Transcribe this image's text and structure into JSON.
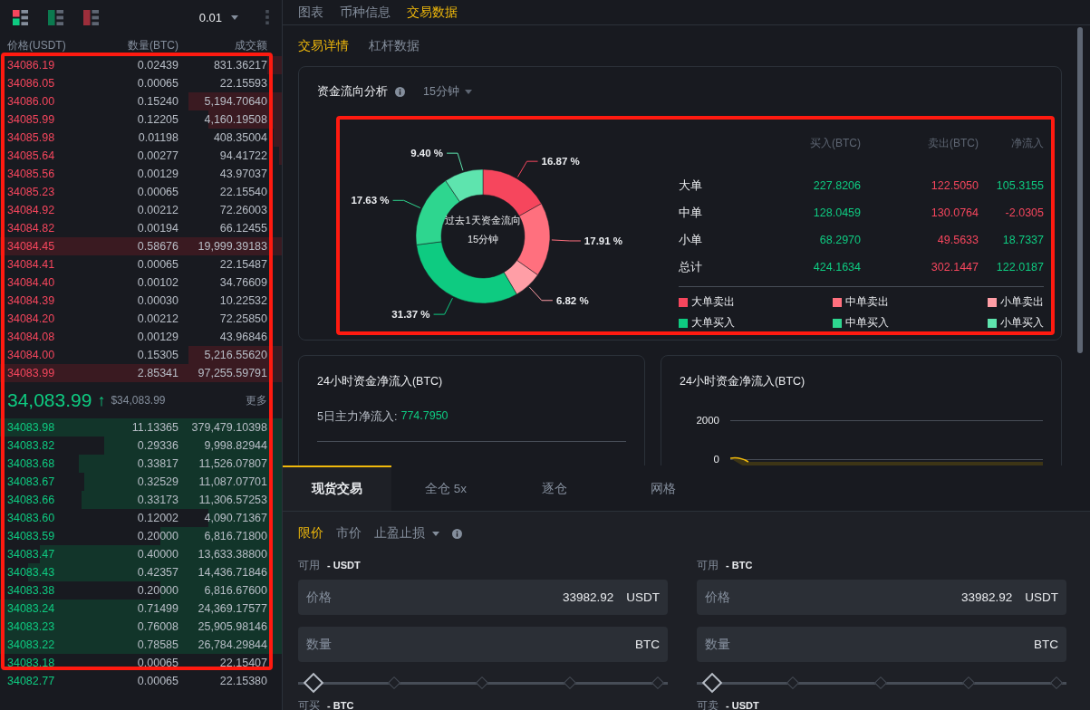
{
  "orderbook": {
    "highlighted": true,
    "precision": "0.01",
    "columns": [
      "价格(USDT)",
      "数量(BTC)",
      "成交额"
    ],
    "asks": [
      {
        "price": "34086.19",
        "quantity": "0.02439",
        "total": "831.36217",
        "level": 0.05
      },
      {
        "price": "34086.05",
        "quantity": "0.00065",
        "total": "22.15593"
      },
      {
        "price": "34086.00",
        "quantity": "0.15240",
        "total": "5,194.70640",
        "level": 0.33
      },
      {
        "price": "34085.99",
        "quantity": "0.12205",
        "total": "4,160.19508",
        "level": 0.26
      },
      {
        "price": "34085.98",
        "quantity": "0.01198",
        "total": "408.35004",
        "level": 0.03
      },
      {
        "price": "34085.64",
        "quantity": "0.00277",
        "total": "94.41722",
        "level": 0.01
      },
      {
        "price": "34085.56",
        "quantity": "0.00129",
        "total": "43.97037"
      },
      {
        "price": "34085.23",
        "quantity": "0.00065",
        "total": "22.15540"
      },
      {
        "price": "34084.92",
        "quantity": "0.00212",
        "total": "72.26003"
      },
      {
        "price": "34084.82",
        "quantity": "0.00194",
        "total": "66.12455"
      },
      {
        "price": "34084.45",
        "quantity": "0.58676",
        "total": "19,999.39183",
        "level": 1
      },
      {
        "price": "34084.41",
        "quantity": "0.00065",
        "total": "22.15487"
      },
      {
        "price": "34084.40",
        "quantity": "0.00102",
        "total": "34.76609"
      },
      {
        "price": "34084.39",
        "quantity": "0.00030",
        "total": "10.22532"
      },
      {
        "price": "34084.20",
        "quantity": "0.00212",
        "total": "72.25850"
      },
      {
        "price": "34084.08",
        "quantity": "0.00129",
        "total": "43.96846"
      },
      {
        "price": "34084.00",
        "quantity": "0.15305",
        "total": "5,216.55620",
        "level": 0.33
      },
      {
        "price": "34083.99",
        "quantity": "2.85341",
        "total": "97,255.59791",
        "level": 1
      }
    ],
    "last_price": {
      "price": "34,083.99",
      "arrow": "↑",
      "usd": "$34,083.99",
      "more": "更多"
    },
    "bids": [
      {
        "price": "34083.98",
        "quantity": "11.13365",
        "total": "379,479.10398",
        "level": 1
      },
      {
        "price": "34083.82",
        "quantity": "0.29336",
        "total": "9,998.82944",
        "level": 0.63
      },
      {
        "price": "34083.68",
        "quantity": "0.33817",
        "total": "11,526.07807",
        "level": 0.72
      },
      {
        "price": "34083.67",
        "quantity": "0.32529",
        "total": "11,087.07701",
        "level": 0.7
      },
      {
        "price": "34083.66",
        "quantity": "0.33173",
        "total": "11,306.57253",
        "level": 0.71
      },
      {
        "price": "34083.60",
        "quantity": "0.12002",
        "total": "4,090.71367",
        "level": 0.26
      },
      {
        "price": "34083.59",
        "quantity": "0.20000",
        "total": "6,816.71800",
        "level": 0.43
      },
      {
        "price": "34083.47",
        "quantity": "0.40000",
        "total": "13,633.38800",
        "level": 0.86
      },
      {
        "price": "34083.43",
        "quantity": "0.42357",
        "total": "14,436.71846",
        "level": 0.9
      },
      {
        "price": "34083.38",
        "quantity": "0.20000",
        "total": "6,816.67600",
        "level": 0.43
      },
      {
        "price": "34083.24",
        "quantity": "0.71499",
        "total": "24,369.17577",
        "level": 1
      },
      {
        "price": "34083.23",
        "quantity": "0.76008",
        "total": "25,905.98146",
        "level": 1
      },
      {
        "price": "34083.22",
        "quantity": "0.78585",
        "total": "26,784.29844",
        "level": 1
      },
      {
        "price": "34083.18",
        "quantity": "0.00065",
        "total": "22.15407"
      },
      {
        "price": "34082.77",
        "quantity": "0.00065",
        "total": "22.15380"
      }
    ]
  },
  "main_tabs": [
    {
      "label": "图表",
      "selected": false
    },
    {
      "label": "币种信息",
      "selected": false
    },
    {
      "label": "交易数据",
      "selected": true
    }
  ],
  "sub_tabs": [
    {
      "label": "交易详情",
      "selected": true
    },
    {
      "label": "杠杆数据",
      "selected": false
    }
  ],
  "flow_analysis": {
    "title": "资金流向分析",
    "interval": "15分钟",
    "highlighted": true,
    "center_title": "过去1天资金流向",
    "center_subtitle": "15分钟",
    "chart_data": {
      "type": "donut",
      "categories": [
        "大单卖出",
        "中单卖出",
        "小单卖出",
        "大单买入",
        "中单买入",
        "小单买入"
      ],
      "values": [
        16.87,
        17.91,
        6.82,
        31.37,
        17.63,
        9.4
      ],
      "value_labels": [
        "16.87 %",
        "17.91 %",
        "6.82 %",
        "31.37 %",
        "17.63 %",
        "9.40 %"
      ]
    },
    "table": {
      "columns": [
        "买入(BTC)",
        "卖出(BTC)",
        "净流入"
      ],
      "rows": [
        {
          "label": "大单",
          "buy": "227.8206",
          "sell": "122.5050",
          "net": "105.3155",
          "net_negative": false
        },
        {
          "label": "中单",
          "buy": "128.0459",
          "sell": "130.0764",
          "net": "-2.0305",
          "net_negative": true
        },
        {
          "label": "小单",
          "buy": "68.2970",
          "sell": "49.5633",
          "net": "18.7337",
          "net_negative": false
        },
        {
          "label": "总计",
          "buy": "424.1634",
          "sell": "302.1447",
          "net": "122.0187",
          "net_negative": false
        }
      ]
    },
    "legend": [
      {
        "color": "#f6465d"
      },
      {
        "color": "#ff707e"
      },
      {
        "color": "#ff9ea6"
      },
      {
        "color": "#0ecb81"
      },
      {
        "color": "#2ed68f"
      },
      {
        "color": "#5ee4ae"
      }
    ]
  },
  "net_inflow_card": {
    "title": "24小时资金净流入(BTC)",
    "five_day_label": "5日主力净流入:",
    "five_day_value": "774.7950"
  },
  "net_inflow_chart_card": {
    "title": "24小时资金净流入(BTC)",
    "y_labels": [
      "2000",
      "0"
    ]
  },
  "trade": {
    "tabs": [
      {
        "label": "现货交易",
        "selected": true
      },
      {
        "label": "全仓 5x",
        "selected": false
      },
      {
        "label": "逐仓",
        "selected": false
      },
      {
        "label": "网格",
        "selected": false
      }
    ],
    "order_types": [
      {
        "label": "限价",
        "selected": true,
        "kind": "plain"
      },
      {
        "label": "市价",
        "selected": false,
        "kind": "plain"
      },
      {
        "label": "止盈止损",
        "selected": false,
        "kind": "dropdown"
      }
    ],
    "sides": [
      {
        "available_label": "可用",
        "available_value": "- USDT",
        "price_label": "价格",
        "price": "33982.92",
        "price_unit": "USDT",
        "amount_label": "数量",
        "amount_unit": "BTC",
        "level": 0,
        "next_label": "可买",
        "next_value": "- BTC"
      },
      {
        "available_label": "可用",
        "available_value": "- BTC",
        "price_label": "价格",
        "price": "33982.92",
        "price_unit": "USDT",
        "amount_label": "数量",
        "amount_unit": "BTC",
        "level": 0,
        "next_label": "可卖",
        "next_value": "- USDT"
      }
    ]
  }
}
